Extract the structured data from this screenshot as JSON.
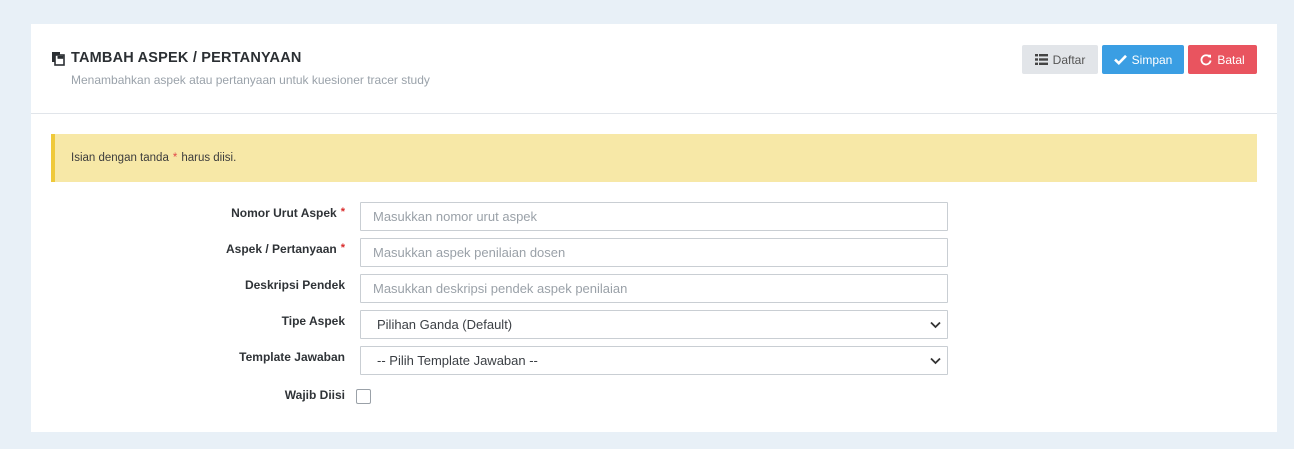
{
  "header": {
    "title": "TAMBAH ASPEK / PERTANYAAN",
    "subtitle": "Menambahkan aspek atau pertanyaan untuk kuesioner tracer study",
    "title_icon": "copy-document-icon"
  },
  "toolbar": {
    "daftar_label": "Daftar",
    "simpan_label": "Simpan",
    "batal_label": "Batal"
  },
  "alert": {
    "text_before": "Isian dengan tanda",
    "marker": "*",
    "text_after": "harus diisi."
  },
  "form": {
    "nomor_urut": {
      "label": "Nomor Urut Aspek",
      "required": "*",
      "placeholder": "Masukkan nomor urut aspek",
      "value": ""
    },
    "aspek": {
      "label": "Aspek / Pertanyaan",
      "required": "*",
      "placeholder": "Masukkan aspek penilaian dosen",
      "value": ""
    },
    "deskripsi": {
      "label": "Deskripsi Pendek",
      "placeholder": "Masukkan deskripsi pendek aspek penilaian",
      "value": ""
    },
    "tipe": {
      "label": "Tipe Aspek",
      "selected": "Pilihan Ganda (Default)"
    },
    "template": {
      "label": "Template Jawaban",
      "selected": "-- Pilih Template Jawaban --"
    },
    "wajib": {
      "label": "Wajib Diisi",
      "checked": false
    }
  },
  "colors": {
    "page_bg": "#e8f0f7",
    "primary": "#3a9ee3",
    "danger": "#e9545f",
    "alert_bg": "#f7e8a7",
    "alert_border": "#efc93a"
  }
}
